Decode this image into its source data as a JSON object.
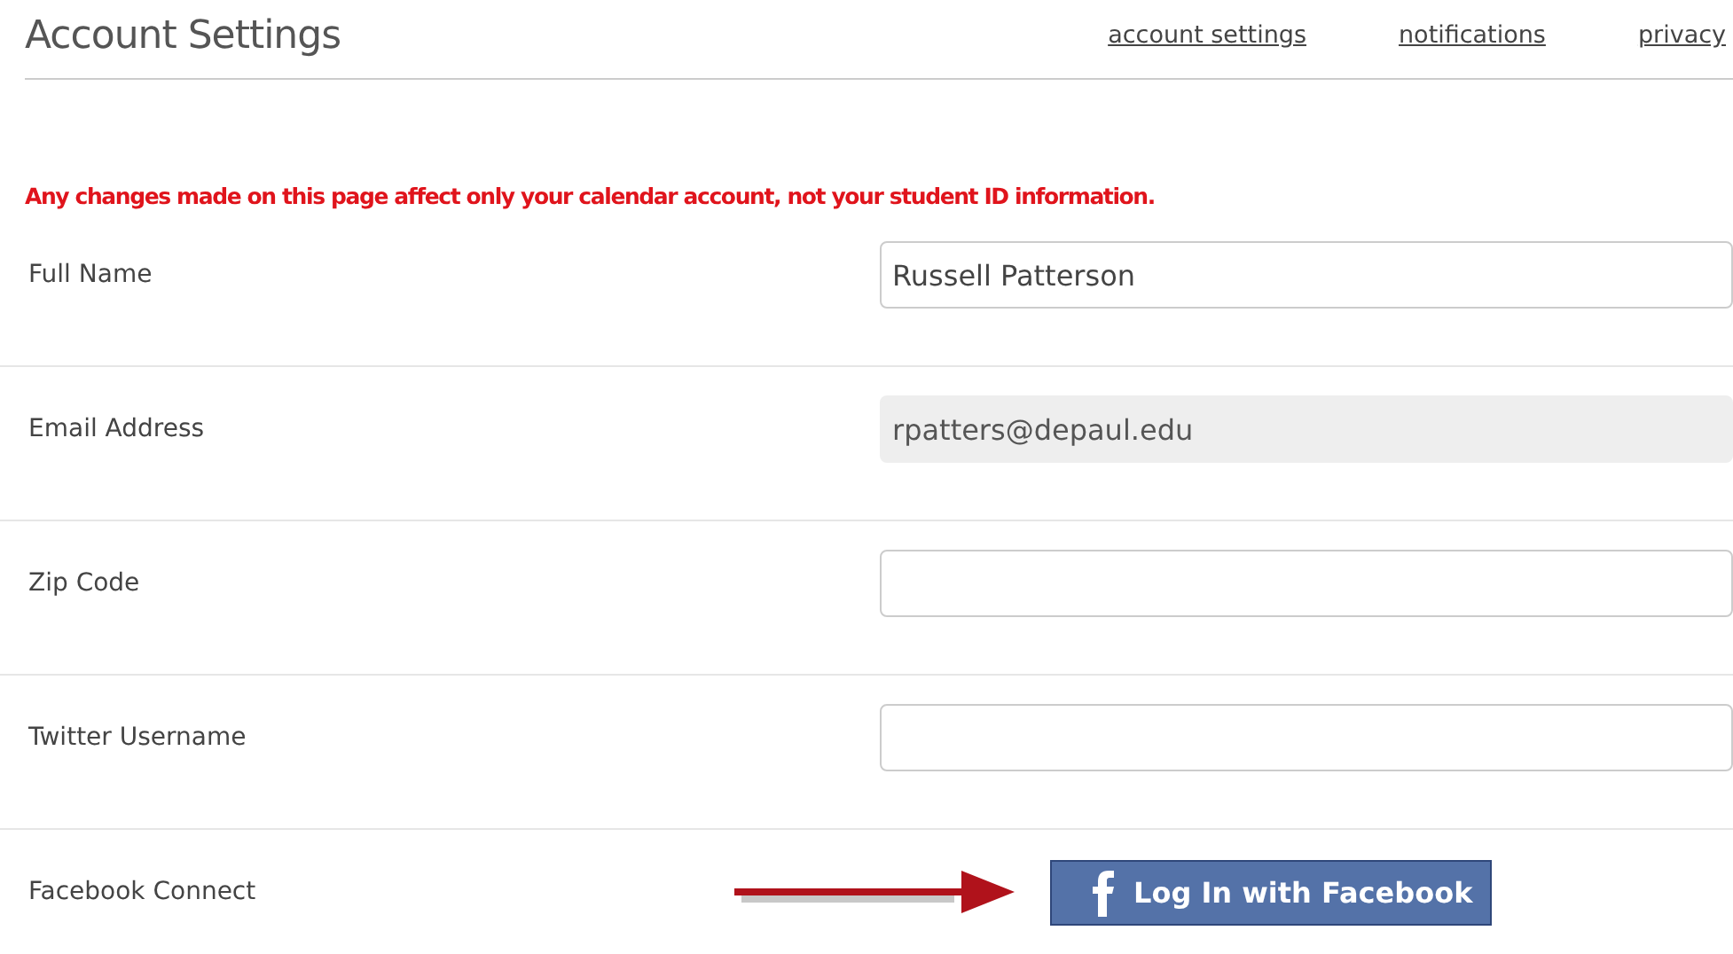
{
  "header": {
    "title": "Account Settings",
    "links": [
      {
        "label": "account settings"
      },
      {
        "label": "notifications"
      },
      {
        "label": "privacy"
      }
    ]
  },
  "notice": "Any changes made on this page affect only your calendar account, not your student ID information.",
  "rows": [
    {
      "kind": "text",
      "label": "Full Name",
      "value": "Russell Patterson",
      "disabled": false
    },
    {
      "kind": "text",
      "label": "Email Address",
      "value": "rpatters@depaul.edu",
      "disabled": true
    },
    {
      "kind": "text",
      "label": "Zip Code",
      "disabled": false
    },
    {
      "kind": "text",
      "label": "Twitter Username",
      "disabled": false
    },
    {
      "kind": "facebook",
      "label": "Facebook Connect",
      "button": "Log In with Facebook"
    }
  ]
}
